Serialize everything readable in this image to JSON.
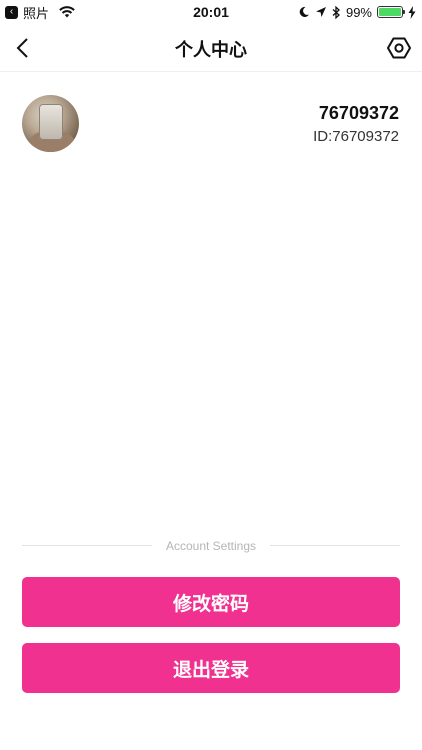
{
  "status_bar": {
    "back_app_label": "照片",
    "time": "20:01",
    "battery_percent": "99%",
    "battery_level": 0.99,
    "icons": [
      "back-app-icon",
      "wifi-icon",
      "moon-icon",
      "location-icon",
      "bluetooth-icon",
      "battery-icon",
      "charging-icon"
    ],
    "battery_color": "#4cd964"
  },
  "nav": {
    "title": "个人中心",
    "back_icon": "chevron-left-icon",
    "settings_icon": "settings-hexagon-icon"
  },
  "profile": {
    "name": "76709372",
    "id_text": "ID:76709372"
  },
  "settings": {
    "section_title": "Account Settings",
    "change_password_label": "修改密码",
    "logout_label": "退出登录",
    "button_color": "#f1318f"
  }
}
